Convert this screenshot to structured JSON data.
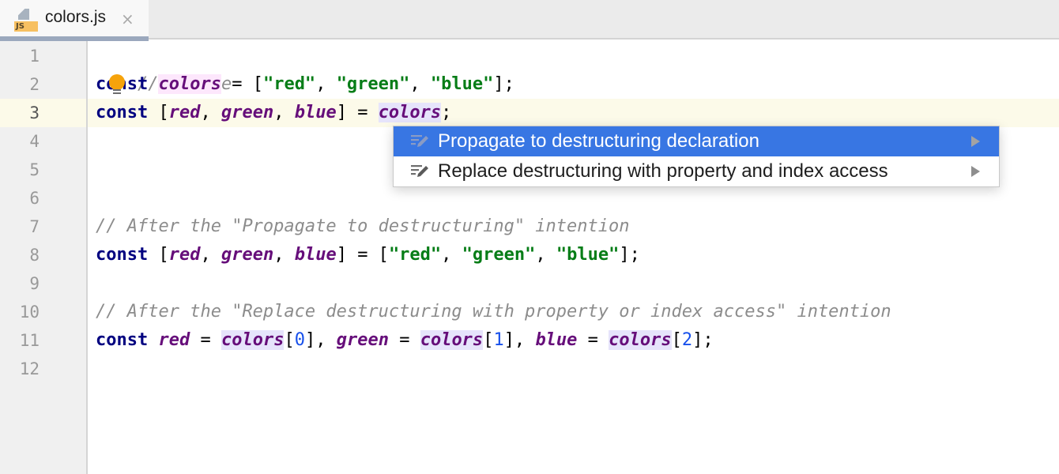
{
  "tab": {
    "file_name": "colors.js",
    "file_type_badge": "JS",
    "close_glyph": "×"
  },
  "gutter": {
    "line_numbers": [
      "1",
      "2",
      "3",
      "4",
      "5",
      "6",
      "7",
      "8",
      "9",
      "10",
      "11",
      "12"
    ],
    "current_line": "3"
  },
  "code": {
    "line1": {
      "comment": "// Before"
    },
    "line2": {
      "kw": "const",
      "sp1": " ",
      "name": "colors",
      "eq": " = [",
      "s1": "\"red\"",
      "c1": ", ",
      "s2": "\"green\"",
      "c2": ", ",
      "s3": "\"blue\"",
      "end": "];"
    },
    "line3": {
      "kw": "const",
      "open": " [",
      "v1": "red",
      "c1": ", ",
      "v2": "green",
      "c2": ", ",
      "v3": "blue",
      "close": "] = ",
      "ref": "colors",
      "end": ";"
    },
    "line7": {
      "pre": "// After the ",
      "q1": "\"",
      "mid": "Propagate to destructuring",
      "q2": "\"",
      "post": " intention"
    },
    "line8": {
      "kw": "const",
      "open": " [",
      "v1": "red",
      "c1": ", ",
      "v2": "green",
      "c2": ", ",
      "v3": "blue",
      "close": "] = [",
      "s1": "\"red\"",
      "c3": ", ",
      "s2": "\"green\"",
      "c4": ", ",
      "s3": "\"blue\"",
      "end": "];"
    },
    "line10": {
      "pre": "// After the ",
      "q1": "\"",
      "mid": "Replace destructuring with property or index access",
      "q2": "\"",
      "post": " intention"
    },
    "line11": {
      "kw": "const",
      "sp": " ",
      "v1": "red",
      "eq1": " = ",
      "r1": "colors",
      "b1o": "[",
      "n1": "0",
      "b1c": "], ",
      "v2": "green",
      "eq2": " = ",
      "r2": "colors",
      "b2o": "[",
      "n2": "1",
      "b2c": "], ",
      "v3": "blue",
      "eq3": " = ",
      "r3": "colors",
      "b3o": "[",
      "n3": "2",
      "b3c": "];"
    }
  },
  "intention_popup": {
    "items": [
      {
        "label": "Propagate to destructuring declaration",
        "selected": true,
        "icon": "intention-edit-icon"
      },
      {
        "label": "Replace destructuring with property and index access",
        "selected": false,
        "icon": "intention-edit-icon"
      }
    ]
  },
  "colors": {
    "selection_accent": "#3876e3",
    "keyword": "#000080",
    "variable": "#660e7a",
    "string": "#067d17",
    "number": "#1750eb",
    "comment": "#8c8c8c",
    "bulb": "#f6a30b",
    "current_line_bg": "#fcfae9"
  }
}
